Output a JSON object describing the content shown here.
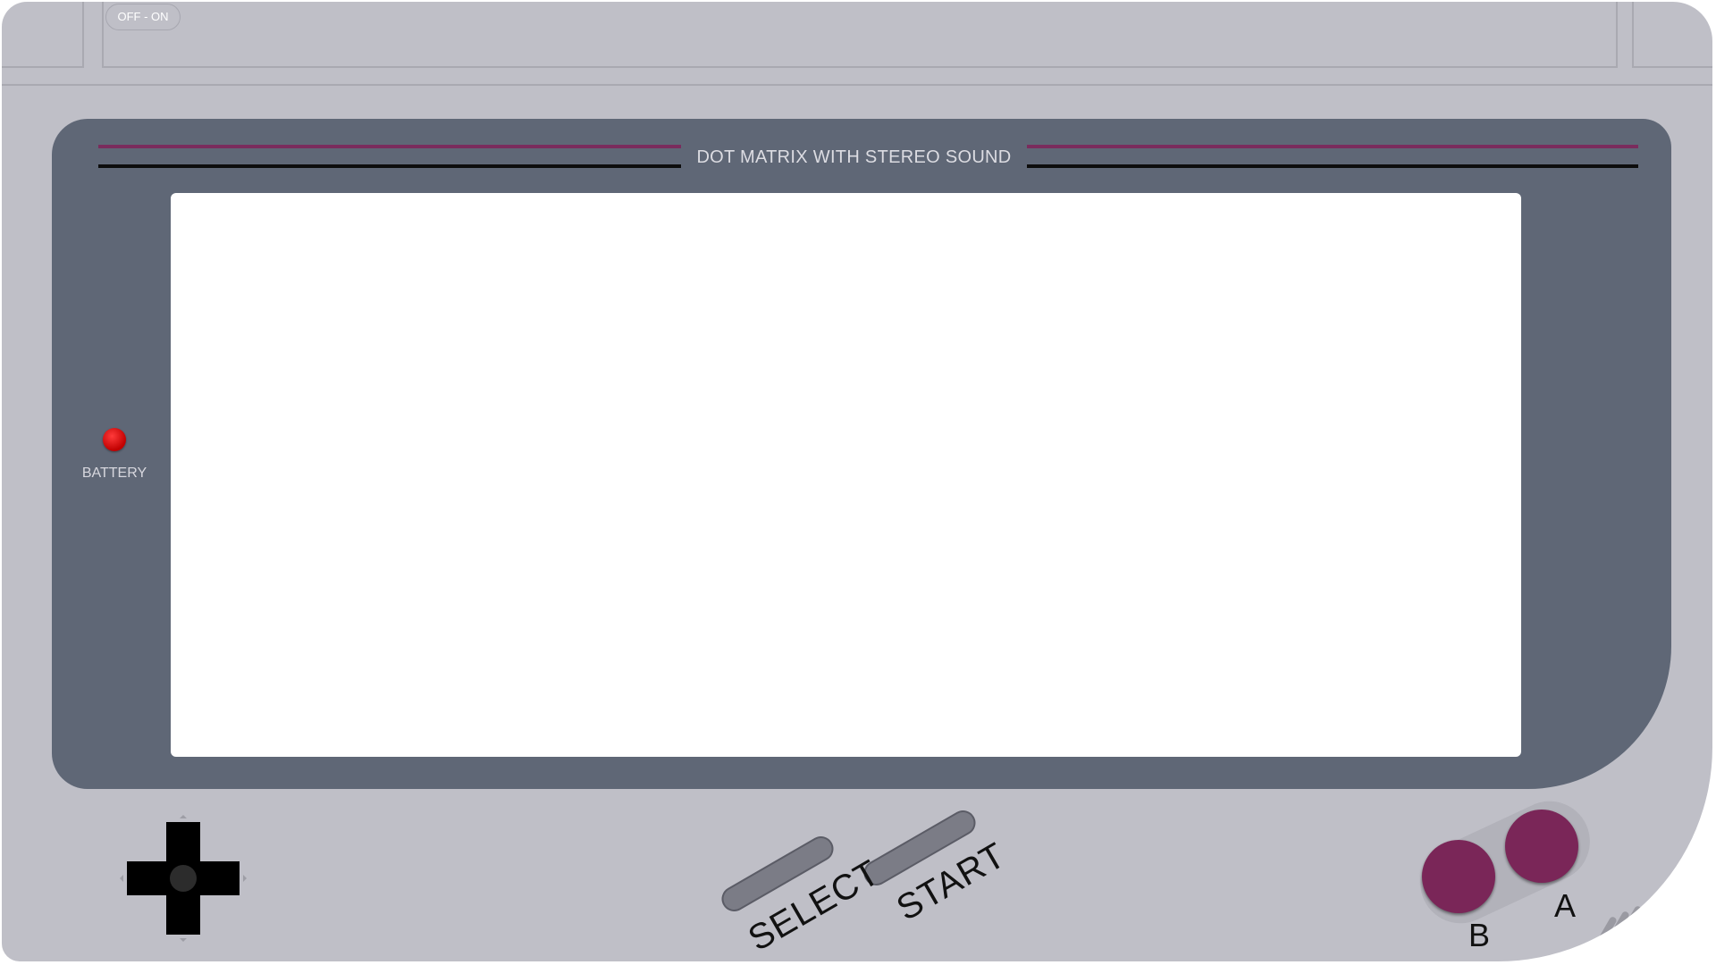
{
  "device": {
    "power_switch_label": "OFF - ON",
    "screen_caption": "DOT MATRIX WITH STEREO SOUND",
    "battery_label": "BATTERY"
  },
  "controls": {
    "select_label": "SELECT",
    "start_label": "START",
    "b_label": "B",
    "a_label": "A"
  },
  "colors": {
    "body": "#bfbfc7",
    "bezel": "#5f6776",
    "accent_button": "#7a2658",
    "stripe_purple": "#7a2c5d",
    "battery_led": "#cc0000"
  },
  "icons": {
    "dpad": "dpad-icon",
    "battery": "battery-led-icon",
    "speaker": "speaker-grille-icon"
  }
}
